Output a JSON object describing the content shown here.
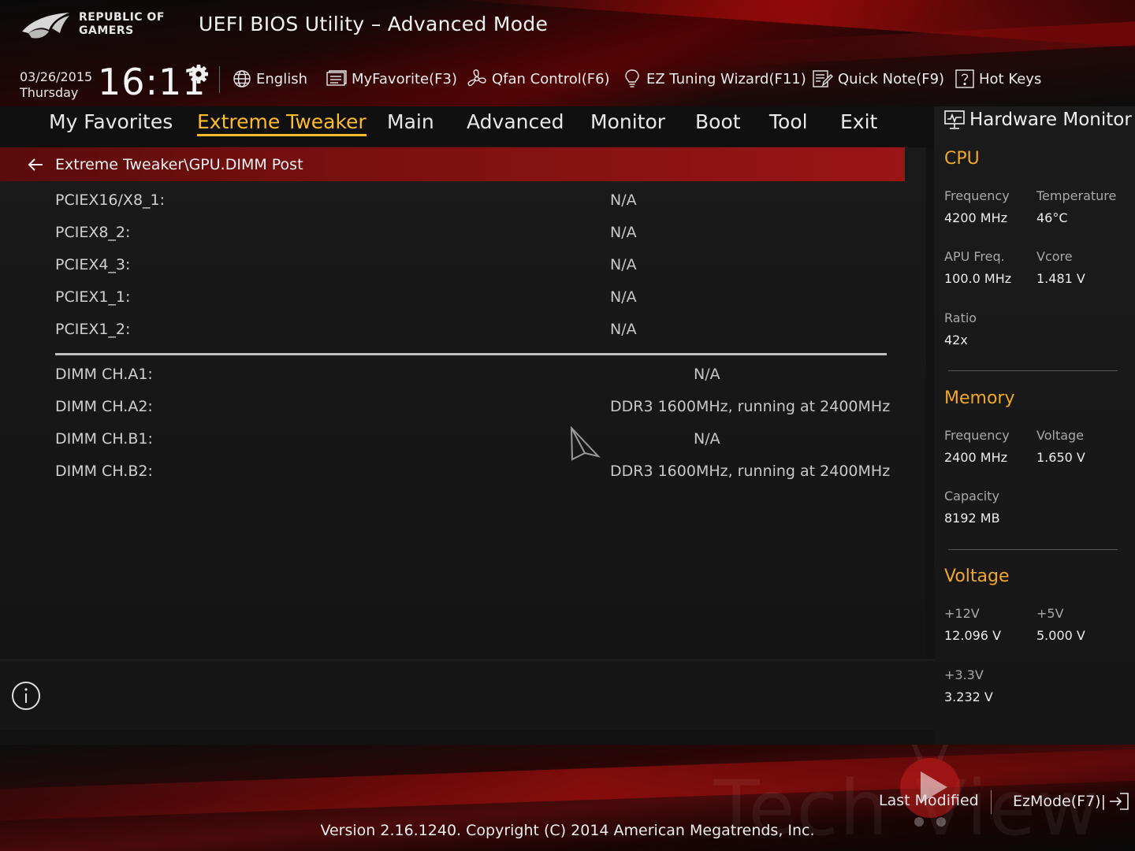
{
  "header": {
    "brand_line1": "REPUBLIC OF",
    "brand_line2": "GAMERS",
    "title": "UEFI BIOS Utility – Advanced Mode",
    "date": "03/26/2015",
    "day": "Thursday",
    "time": "16:11",
    "toolbar": {
      "language": "English",
      "myfavorite": "MyFavorite(F3)",
      "qfan": "Qfan Control(F6)",
      "ez_tuning": "EZ Tuning Wizard(F11)",
      "quick_note": "Quick Note(F9)",
      "hot_keys": "Hot Keys"
    }
  },
  "tabs": [
    {
      "label": "My Favorites",
      "active": false
    },
    {
      "label": "Extreme Tweaker",
      "active": true
    },
    {
      "label": "Main",
      "active": false
    },
    {
      "label": "Advanced",
      "active": false
    },
    {
      "label": "Monitor",
      "active": false
    },
    {
      "label": "Boot",
      "active": false
    },
    {
      "label": "Tool",
      "active": false
    },
    {
      "label": "Exit",
      "active": false
    }
  ],
  "breadcrumb": "Extreme Tweaker\\GPU.DIMM Post",
  "pcie_slots": [
    {
      "label": "PCIEX16/X8_1:",
      "value": "N/A"
    },
    {
      "label": "PCIEX8_2:",
      "value": "N/A"
    },
    {
      "label": "PCIEX4_3:",
      "value": "N/A"
    },
    {
      "label": "PCIEX1_1:",
      "value": "N/A"
    },
    {
      "label": "PCIEX1_2:",
      "value": "N/A"
    }
  ],
  "dimm_slots": [
    {
      "label": "DIMM CH.A1:",
      "value": "N/A"
    },
    {
      "label": "DIMM CH.A2:",
      "value": "DDR3 1600MHz, running at 2400MHz"
    },
    {
      "label": "DIMM CH.B1:",
      "value": "N/A"
    },
    {
      "label": "DIMM CH.B2:",
      "value": "DDR3 1600MHz, running at 2400MHz"
    }
  ],
  "hardware_monitor": {
    "title": "Hardware Monitor",
    "cpu": {
      "heading": "CPU",
      "frequency_label": "Frequency",
      "frequency": "4200 MHz",
      "temperature_label": "Temperature",
      "temperature": "46°C",
      "apu_label": "APU Freq.",
      "apu": "100.0 MHz",
      "vcore_label": "Vcore",
      "vcore": "1.481 V",
      "ratio_label": "Ratio",
      "ratio": "42x"
    },
    "memory": {
      "heading": "Memory",
      "frequency_label": "Frequency",
      "frequency": "2400 MHz",
      "voltage_label": "Voltage",
      "voltage": "1.650 V",
      "capacity_label": "Capacity",
      "capacity": "8192 MB"
    },
    "voltage": {
      "heading": "Voltage",
      "v12_label": "+12V",
      "v12": "12.096 V",
      "v5_label": "+5V",
      "v5": "5.000 V",
      "v33_label": "+3.3V",
      "v33": "3.232 V"
    }
  },
  "footer": {
    "last_modified": "Last Modified",
    "ezmode": "EzMode(F7)|",
    "version": "Version 2.16.1240. Copyright (C) 2014 American Megatrends, Inc.",
    "watermark": "Tech View"
  },
  "colors": {
    "accent": "#ffbb28",
    "section": "#f0a828",
    "breadcrumb": "#8a1212"
  }
}
